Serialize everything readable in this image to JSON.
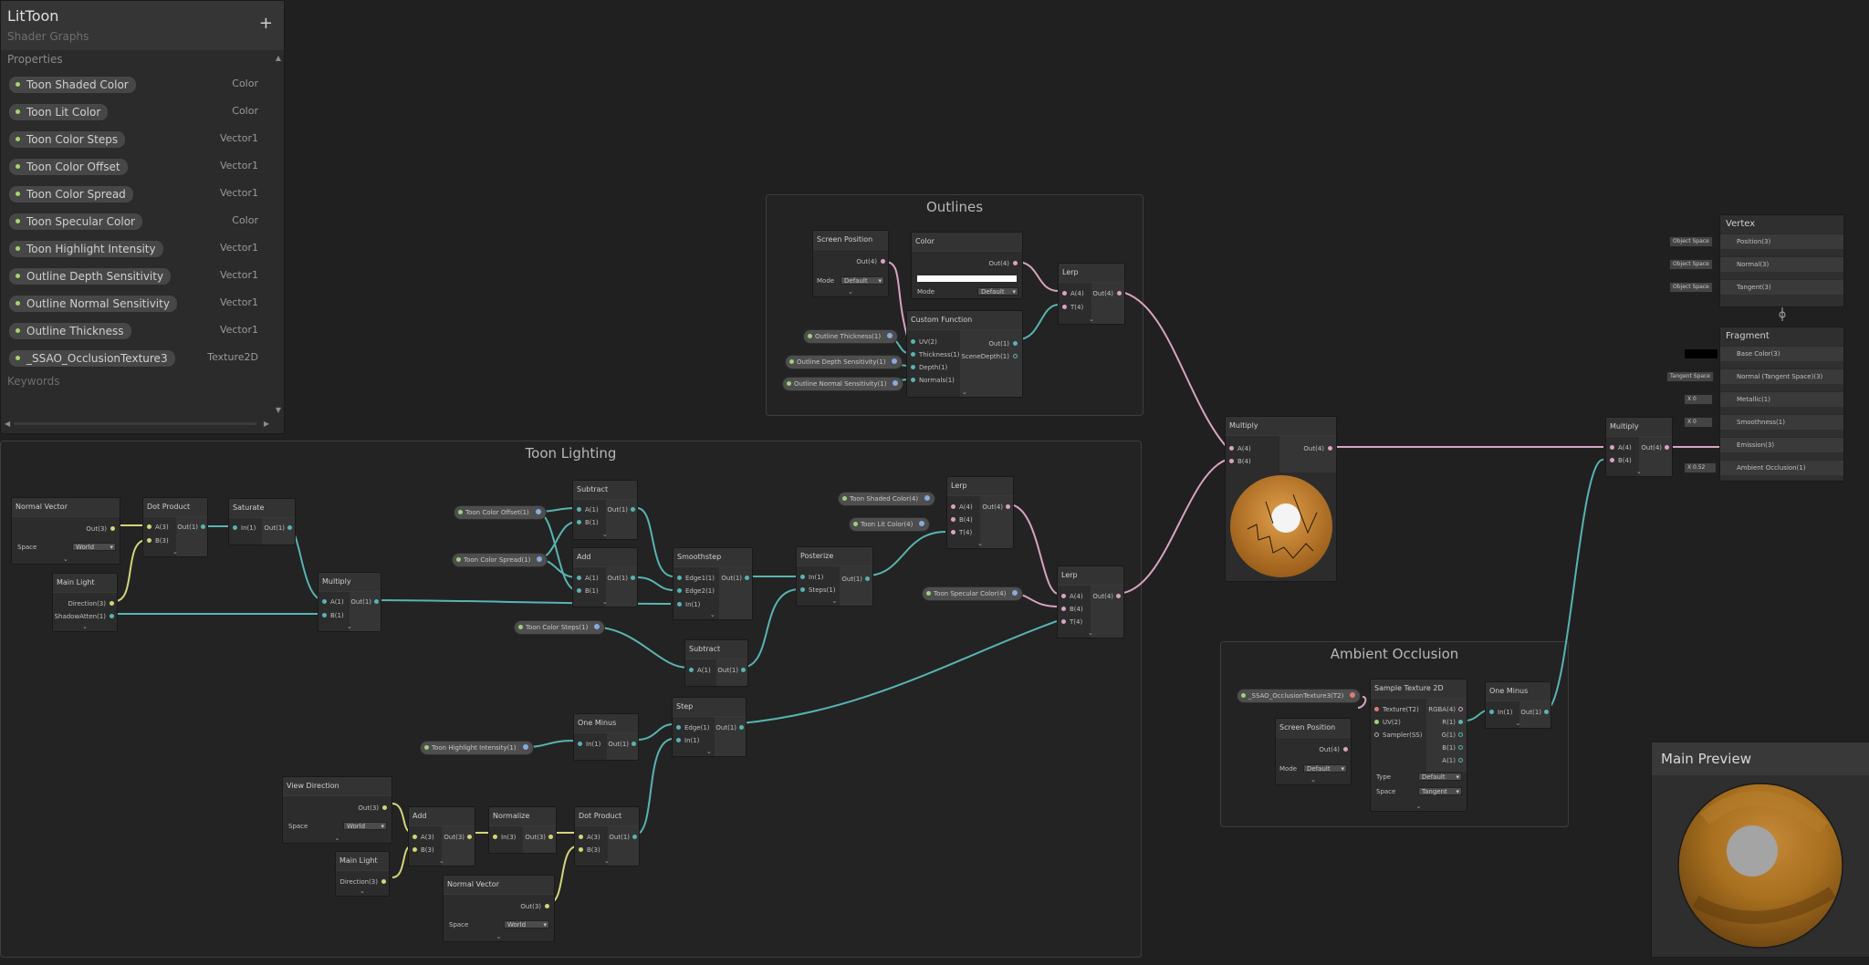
{
  "blackboard": {
    "title": "LitToon",
    "subtitle": "Shader Graphs",
    "add_label": "+",
    "properties_header": "Properties",
    "keywords_header": "Keywords",
    "properties": [
      {
        "name": "Toon Shaded Color",
        "type": "Color"
      },
      {
        "name": "Toon Lit Color",
        "type": "Color"
      },
      {
        "name": "Toon Color Steps",
        "type": "Vector1"
      },
      {
        "name": "Toon Color Offset",
        "type": "Vector1"
      },
      {
        "name": "Toon Color Spread",
        "type": "Vector1"
      },
      {
        "name": "Toon Specular Color",
        "type": "Color"
      },
      {
        "name": "Toon Highlight Intensity",
        "type": "Vector1"
      },
      {
        "name": "Outline Depth Sensitivity",
        "type": "Vector1"
      },
      {
        "name": "Outline Normal Sensitivity",
        "type": "Vector1"
      },
      {
        "name": "Outline Thickness",
        "type": "Vector1"
      },
      {
        "name": "_SSAO_OcclusionTexture3",
        "type": "Texture2D"
      }
    ]
  },
  "groups": {
    "outlines": "Outlines",
    "toon_lighting": "Toon Lighting",
    "ambient_occlusion": "Ambient Occlusion"
  },
  "nodes": {
    "screen_position": {
      "title": "Screen Position",
      "out": "Out(4)",
      "mode_label": "Mode",
      "mode_value": "Default"
    },
    "color": {
      "title": "Color",
      "out": "Out(4)",
      "mode_label": "Mode",
      "mode_value": "Default"
    },
    "custom_function": {
      "title": "Custom Function",
      "in": [
        "UV(2)",
        "Thickness(1)",
        "Depth(1)",
        "Normals(1)"
      ],
      "out1": "Out(1)",
      "out2": "SceneDepth(1)"
    },
    "lerp_outline": {
      "title": "Lerp",
      "in": [
        "A(4)",
        "T(4)"
      ],
      "out": "Out(4)"
    },
    "normal_vector": {
      "title": "Normal Vector",
      "out": "Out(3)",
      "space_label": "Space",
      "space_value": "World"
    },
    "main_light": {
      "title": "Main Light",
      "out1": "Direction(3)",
      "out2": "ShadowAtten(1)"
    },
    "dot_product": {
      "title": "Dot Product",
      "in": [
        "A(3)",
        "B(3)"
      ],
      "out": "Out(1)"
    },
    "saturate": {
      "title": "Saturate",
      "in": [
        "In(1)"
      ],
      "out": "Out(1)"
    },
    "multiply_light": {
      "title": "Multiply",
      "in": [
        "A(1)",
        "B(1)"
      ],
      "out": "Out(1)"
    },
    "subtract_top": {
      "title": "Subtract",
      "in": [
        "A(1)",
        "B(1)"
      ],
      "out": "Out(1)"
    },
    "add_top": {
      "title": "Add",
      "in": [
        "A(1)",
        "B(1)"
      ],
      "out": "Out(1)"
    },
    "smoothstep": {
      "title": "Smoothstep",
      "in": [
        "Edge1(1)",
        "Edge2(1)",
        "In(1)"
      ],
      "out": "Out(1)"
    },
    "posterize": {
      "title": "Posterize",
      "in": [
        "In(1)",
        "Steps(1)"
      ],
      "out": "Out(1)"
    },
    "lerp_color": {
      "title": "Lerp",
      "in": [
        "A(4)",
        "B(4)",
        "T(4)"
      ],
      "out": "Out(4)"
    },
    "lerp_spec": {
      "title": "Lerp",
      "in": [
        "A(4)",
        "B(4)",
        "T(4)"
      ],
      "out": "Out(4)"
    },
    "subtract_low": {
      "title": "Subtract",
      "in": [
        "A(1)"
      ],
      "out": "Out(1)"
    },
    "one_minus_low": {
      "title": "One Minus",
      "in": [
        "In(1)"
      ],
      "out": "Out(1)"
    },
    "step": {
      "title": "Step",
      "in": [
        "Edge(1)",
        "In(1)"
      ],
      "out": "Out(1)"
    },
    "view_direction": {
      "title": "View Direction",
      "out": "Out(3)",
      "space_label": "Space",
      "space_value": "World"
    },
    "main_light_2": {
      "title": "Main Light",
      "out1": "Direction(3)"
    },
    "add_view": {
      "title": "Add",
      "in": [
        "A(3)",
        "B(3)"
      ],
      "out": "Out(3)"
    },
    "normalize": {
      "title": "Normalize",
      "in": [
        "In(3)"
      ],
      "out": "Out(3)"
    },
    "dot_product_2": {
      "title": "Dot Product",
      "in": [
        "A(3)",
        "B(3)"
      ],
      "out": "Out(1)"
    },
    "normal_vector_2": {
      "title": "Normal Vector",
      "out": "Out(3)",
      "space_label": "Space",
      "space_value": "World"
    },
    "multiply_main": {
      "title": "Multiply",
      "in": [
        "A(4)",
        "B(4)"
      ],
      "out": "Out(4)"
    },
    "multiply_final": {
      "title": "Multiply",
      "in": [
        "A(4)",
        "B(4)"
      ],
      "out": "Out(4)"
    },
    "sample_texture": {
      "title": "Sample Texture 2D",
      "in": [
        "Texture(T2)",
        "UV(2)",
        "Sampler(SS)"
      ],
      "out": [
        "RGBA(4)",
        "R(1)",
        "G(1)",
        "B(1)",
        "A(1)"
      ],
      "type_label": "Type",
      "type_value": "Default",
      "space_label": "Space",
      "space_value": "Tangent"
    },
    "one_minus_ao": {
      "title": "One Minus",
      "in": [
        "In(1)"
      ],
      "out": "Out(1)"
    },
    "screen_position_ao": {
      "title": "Screen Position",
      "out": "Out(4)",
      "mode_label": "Mode",
      "mode_value": "Default"
    }
  },
  "pills": {
    "outline_thickness": "Outline Thickness(1)",
    "outline_depth": "Outline Depth Sensitivity(1)",
    "outline_normal": "Outline Normal Sensitivity(1)",
    "toon_color_offset": "Toon Color Offset(1)",
    "toon_color_spread": "Toon Color Spread(1)",
    "toon_color_steps": "Toon Color Steps(1)",
    "toon_highlight": "Toon Highlight Intensity(1)",
    "toon_shaded": "Toon Shaded Color(4)",
    "toon_lit": "Toon Lit Color(4)",
    "toon_specular": "Toon Specular Color(4)",
    "ssao": "_SSAO_OcclusionTexture3(T2)"
  },
  "master": {
    "vertex_title": "Vertex",
    "vertex_inputs": [
      {
        "label": "Position(3)",
        "ext": "Object Space"
      },
      {
        "label": "Normal(3)",
        "ext": "Object Space"
      },
      {
        "label": "Tangent(3)",
        "ext": "Object Space"
      }
    ],
    "fragment_title": "Fragment",
    "fragment_inputs": [
      {
        "label": "Base Color(3)",
        "ext": ""
      },
      {
        "label": "Normal (Tangent Space)(3)",
        "ext": "Tangent Space"
      },
      {
        "label": "Metallic(1)",
        "ext": "X  0"
      },
      {
        "label": "Smoothness(1)",
        "ext": "X  0"
      },
      {
        "label": "Emission(3)",
        "ext": ""
      },
      {
        "label": "Ambient Occlusion(1)",
        "ext": "X  0.52"
      }
    ]
  },
  "preview": {
    "title": "Main Preview"
  },
  "colors": {
    "float_wire": "#58b4b0",
    "vector_wire": "#d9a3c2",
    "vec3_wire": "#d4d47a",
    "graph_bg": "#202020",
    "property_dot": "#a7d56e"
  }
}
